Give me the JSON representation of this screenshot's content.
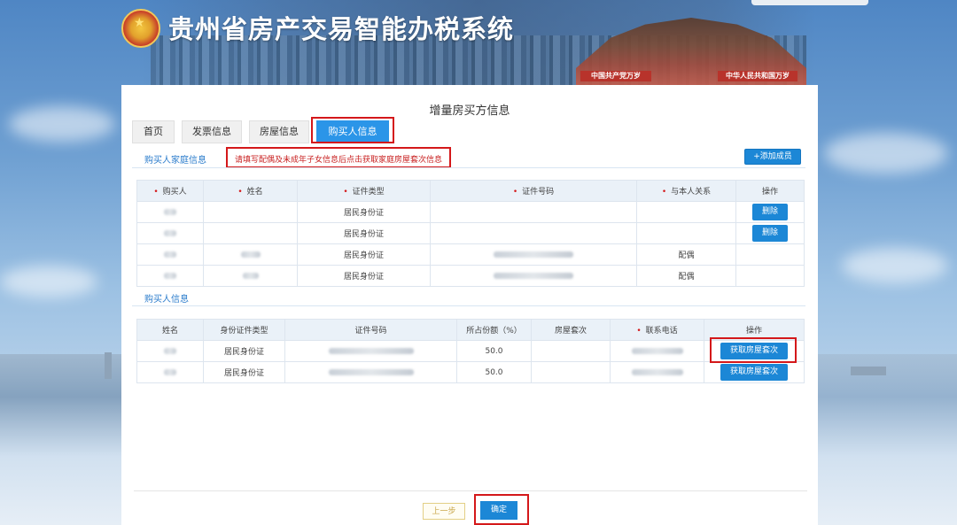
{
  "app": {
    "title": "贵州省房产交易智能办税系统",
    "banner_signs": [
      "中国共产党万岁",
      "中华人民共和国万岁"
    ]
  },
  "page": {
    "title": "增量房买方信息"
  },
  "tabs": [
    {
      "label": "首页",
      "active": false
    },
    {
      "label": "发票信息",
      "active": false
    },
    {
      "label": "房屋信息",
      "active": false
    },
    {
      "label": "购买人信息",
      "active": true
    }
  ],
  "family_section": {
    "label": "购买人家庭信息",
    "notice": "请填写配偶及未成年子女信息后点击获取家庭房屋套次信息",
    "add_button": "+添加成员",
    "columns": [
      "购买人",
      "姓名",
      "证件类型",
      "证件号码",
      "与本人关系",
      "操作"
    ],
    "required_columns": [
      true,
      true,
      true,
      true,
      true,
      false
    ],
    "rows": [
      {
        "id_type": "居民身份证",
        "relation": "",
        "action": "删除"
      },
      {
        "id_type": "居民身份证",
        "relation": "",
        "action": "删除"
      },
      {
        "id_type": "居民身份证",
        "relation": "配偶",
        "action": ""
      },
      {
        "id_type": "居民身份证",
        "relation": "配偶",
        "action": ""
      }
    ]
  },
  "buyer_section": {
    "label": "购买人信息",
    "columns": [
      "姓名",
      "身份证件类型",
      "证件号码",
      "所占份额（%）",
      "房屋套次",
      "联系电话",
      "操作"
    ],
    "required_columns": [
      false,
      false,
      false,
      false,
      false,
      true,
      false
    ],
    "rows": [
      {
        "id_type": "居民身份证",
        "share": "50.0",
        "house_count": "",
        "action": "获取房屋套次"
      },
      {
        "id_type": "居民身份证",
        "share": "50.0",
        "house_count": "",
        "action": "获取房屋套次"
      }
    ]
  },
  "footer": {
    "prev_button": "上一步",
    "confirm_button": "确定"
  },
  "colors": {
    "accent": "#1c87d6",
    "tab_active": "#2b95e8",
    "highlight_box": "#d4181a",
    "notice_text": "#c82020"
  }
}
